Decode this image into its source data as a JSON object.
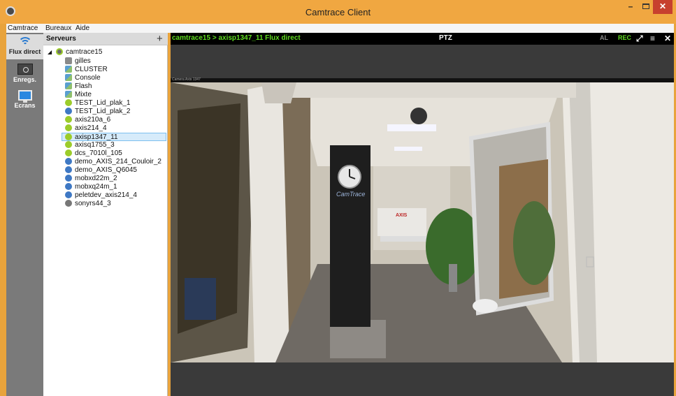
{
  "window": {
    "title": "Camtrace Client",
    "min": "–",
    "close": "✕"
  },
  "menu": [
    "Camtrace",
    "Bureaux",
    "Aide"
  ],
  "nav": [
    {
      "label": "Flux direct",
      "icon": "wifi-icon",
      "active": true
    },
    {
      "label": "Enregs.",
      "icon": "recordings-icon",
      "active": false
    },
    {
      "label": "Ecrans",
      "icon": "screens-icon",
      "active": false
    }
  ],
  "servers": {
    "header": "Serveurs",
    "add": "+",
    "root": "camtrace15",
    "items": [
      {
        "label": "gilles",
        "kind": "server"
      },
      {
        "label": "CLUSTER",
        "kind": "group"
      },
      {
        "label": "Console",
        "kind": "group"
      },
      {
        "label": "Flash",
        "kind": "group"
      },
      {
        "label": "Mixte",
        "kind": "group"
      },
      {
        "label": "TEST_Lid_plak_1",
        "kind": "cam-green"
      },
      {
        "label": "TEST_Lid_plak_2",
        "kind": "cam-blue"
      },
      {
        "label": "axis210a_6",
        "kind": "cam-green"
      },
      {
        "label": "axis214_4",
        "kind": "cam-green"
      },
      {
        "label": "axisp1347_11",
        "kind": "cam-green",
        "selected": true
      },
      {
        "label": "axisq1755_3",
        "kind": "cam-green"
      },
      {
        "label": "dcs_7010l_105",
        "kind": "cam-green"
      },
      {
        "label": "demo_AXIS_214_Couloir_2",
        "kind": "cam-blue"
      },
      {
        "label": "demo_AXIS_Q6045",
        "kind": "cam-blue"
      },
      {
        "label": "mobxd22m_2",
        "kind": "cam-blue"
      },
      {
        "label": "mobxq24m_1",
        "kind": "cam-blue"
      },
      {
        "label": "peletdev_axis214_4",
        "kind": "cam-blue"
      },
      {
        "label": "sonyrs44_3",
        "kind": "cam-grey"
      }
    ]
  },
  "viewer": {
    "path": "camtrace15 > axisp1347_11  Flux direct",
    "ptz": "PTZ",
    "al": "AL",
    "rec": "REC",
    "expand": "⤢",
    "menu": "≡",
    "close": "✕",
    "overlay": "Camera Axis 1347",
    "sign_brand": "CamTrace",
    "sign_axis": "AXIS"
  },
  "colors": {
    "accent": "#f0a741",
    "live_green": "#5fdc1f",
    "selection": "#d6ebfa"
  }
}
